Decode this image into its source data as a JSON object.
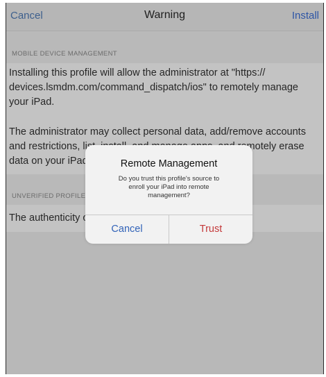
{
  "navbar": {
    "cancel_label": "Cancel",
    "title": "Warning",
    "install_label": "Install"
  },
  "mdm_section": {
    "header": "MOBILE DEVICE MANAGEMENT",
    "paragraph1_lines": [
      "Installing this profile will allow the administrator at \"https://",
      "devices.lsmdm.com/command_dispatch/ios\" to remotely manage",
      "your iPad."
    ],
    "paragraph2_lines": [
      "The administrator may collect personal data, add/remove accounts",
      "and restrictions, list, install, and manage apps, and remotely erase",
      "data on your iPad."
    ]
  },
  "unverified_section": {
    "header": "UNVERIFIED PROFILE",
    "text": "The authenticity of \"MDM\" cannot be verified."
  },
  "alert": {
    "title": "Remote Management",
    "message_lines": [
      "Do you trust this profile's source to",
      "enroll your iPad into remote",
      "management?"
    ],
    "cancel_label": "Cancel",
    "trust_label": "Trust"
  },
  "colors": {
    "link_blue": "#2d55a6",
    "destructive_red": "#c4393a",
    "dimmed_background": "#b9b9b9"
  }
}
